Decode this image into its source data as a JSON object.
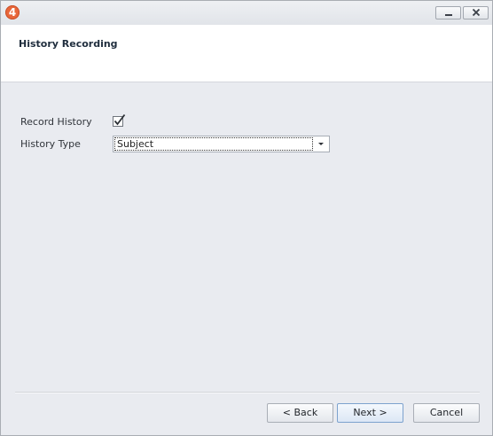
{
  "window": {
    "icon_glyph": "4",
    "controls": {
      "minimize_icon": "minimize-icon",
      "close_icon": "close-icon"
    }
  },
  "header": {
    "title": "History Recording"
  },
  "form": {
    "record_history": {
      "label": "Record History",
      "checked": true
    },
    "history_type": {
      "label": "History Type",
      "value": "Subject"
    }
  },
  "footer": {
    "back_label": "< Back",
    "next_label": "Next >",
    "cancel_label": "Cancel"
  },
  "colors": {
    "app_icon": "#e8663a",
    "body_background": "#e9ebf0",
    "header_background": "#ffffff",
    "default_button_border": "#7da2ce"
  }
}
